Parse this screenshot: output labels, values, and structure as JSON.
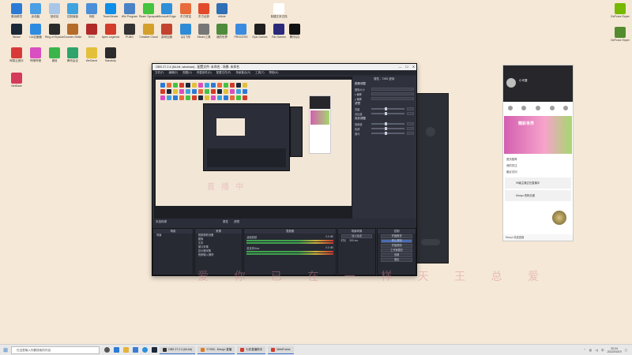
{
  "desktop_icons": [
    {
      "label": "驱动精灵",
      "color": "#2b7bd6"
    },
    {
      "label": "此电脑",
      "color": "#4b9fe4"
    },
    {
      "label": "回收站",
      "color": "#a8c7e8"
    },
    {
      "label": "控制面板",
      "color": "#3fa3df"
    },
    {
      "label": "网络",
      "color": "#4a8fd8"
    },
    {
      "label": "TeamViewer",
      "color": "#0e8ee9"
    },
    {
      "label": "Win Program",
      "color": "#4b82c6"
    },
    {
      "label": "Razer Synapse",
      "color": "#44c43f"
    },
    {
      "label": "Microsoft Edge",
      "color": "#2f8fd8"
    },
    {
      "label": "东方财富",
      "color": "#e86b3b"
    },
    {
      "label": "东方证券",
      "color": "#e24a2c"
    },
    {
      "label": "eMule",
      "color": "#2f6fb6"
    },
    {
      "label": "新建文本文档",
      "color": "#ffffff"
    },
    {
      "label": "Steam",
      "color": "#1b2838"
    },
    {
      "label": "UU加速器",
      "color": "#2d8be0"
    },
    {
      "label": "Ring of Elysium",
      "color": "#2b2b2b"
    },
    {
      "label": "Counter-Strike",
      "color": "#b56b2a"
    },
    {
      "label": "ROG",
      "color": "#b02a2a"
    },
    {
      "label": "Apex Legends",
      "color": "#d33b2a"
    },
    {
      "label": "PUBG",
      "color": "#333333"
    },
    {
      "label": "Creative Cloud",
      "color": "#d4a02c"
    },
    {
      "label": "游戏加速",
      "color": "#c4432f"
    },
    {
      "label": "QQ飞车",
      "color": "#2e8cd6"
    },
    {
      "label": "Steam工具",
      "color": "#777777"
    },
    {
      "label": "我的世界",
      "color": "#4f8b3b"
    },
    {
      "label": "PROCESS",
      "color": "#3a8be0"
    },
    {
      "label": "Epic Games",
      "color": "#1f1f1f"
    },
    {
      "label": "Rio Games",
      "color": "#2a2a7a"
    },
    {
      "label": "腾讯QQ",
      "color": "#111111"
    },
    {
      "label": "网易云音乐",
      "color": "#d83a3a"
    },
    {
      "label": "哔哩哔哩",
      "color": "#d94ec0"
    },
    {
      "label": "微信",
      "color": "#39b549"
    },
    {
      "label": "腾讯会议",
      "color": "#2ea36b"
    },
    {
      "label": "WeGame",
      "color": "#e4c03a"
    },
    {
      "label": "Bandizip",
      "color": "#2b2b2b"
    },
    {
      "label": "NetEase",
      "color": "#d43a5a"
    }
  ],
  "right_desktop_icons": [
    {
      "label": "GeForce Experience",
      "color": "#76b900"
    },
    {
      "label": "GeForce Experience",
      "color": "#558b2f"
    }
  ],
  "obs": {
    "title": "OBS 27.2.4 (64-bit, windows) - 配置文件: 未命名 - 场景: 未命名",
    "menu": [
      "文件(F)",
      "编辑(E)",
      "视图(V)",
      "停靠部件(D)",
      "配置文件(P)",
      "场景集合(S)",
      "工具(T)",
      "帮助(H)"
    ],
    "props_title": "属性 - 'OBS 虚拟'",
    "props_sections": [
      "图像调整",
      "滤镜",
      "色彩调整"
    ],
    "props_rows": [
      "图像大小",
      "x 偏移",
      "y 偏移",
      "亮度",
      "对比度",
      "饱和度",
      "色调",
      "伽马"
    ],
    "status_left": "未选择源",
    "status_buttons": [
      "属性",
      "滤镜"
    ],
    "docks": {
      "scenes": {
        "title": "场景",
        "items": [
          "场景"
        ]
      },
      "sources": {
        "title": "来源",
        "items": [
          "视频捕获设备",
          "图像",
          "文本",
          "窗口采集",
          "显示器采集",
          "音频输入捕获"
        ]
      },
      "mixer": {
        "title": "混音器",
        "channels": [
          "桌面音频",
          "麦克风/Aux"
        ],
        "db": [
          "0.0 dB",
          "0.0 dB"
        ]
      },
      "transitions": {
        "title": "场景转换",
        "mode": "淡入淡出",
        "duration_label": "时长",
        "duration": "300 ms"
      },
      "controls": {
        "title": "控制",
        "buttons": [
          "开始推流",
          "停止录制",
          "开始录制",
          "工作室模式",
          "设置",
          "退出"
        ]
      }
    }
  },
  "chat": {
    "username": "小可爱",
    "banner_text": "精彩世界",
    "list_items": [
      "首页推荐",
      "我的关注",
      "最近访问"
    ],
    "card1": "99级主播正在直播中",
    "card2": "Mooyo 的粉丝团",
    "bottom_text": "Mooyo 精选直播"
  },
  "watermark": "爱 你 已 在 一 样 天 王 总 爱",
  "watermark2": "直播中",
  "taskbar": {
    "search_placeholder": "在这里输入你要搜索的内容",
    "apps": [
      {
        "label": "OBS 27.2.4 (64-bit)",
        "color": "#333"
      },
      {
        "label": "YY090 - Mooyo 直播",
        "color": "#e07a1f"
      },
      {
        "label": "七彩直播助手",
        "color": "#d43a2a"
      },
      {
        "label": "WebFrame",
        "color": "#d43a2a"
      }
    ],
    "time": "20:24",
    "date": "2022/03/19"
  }
}
